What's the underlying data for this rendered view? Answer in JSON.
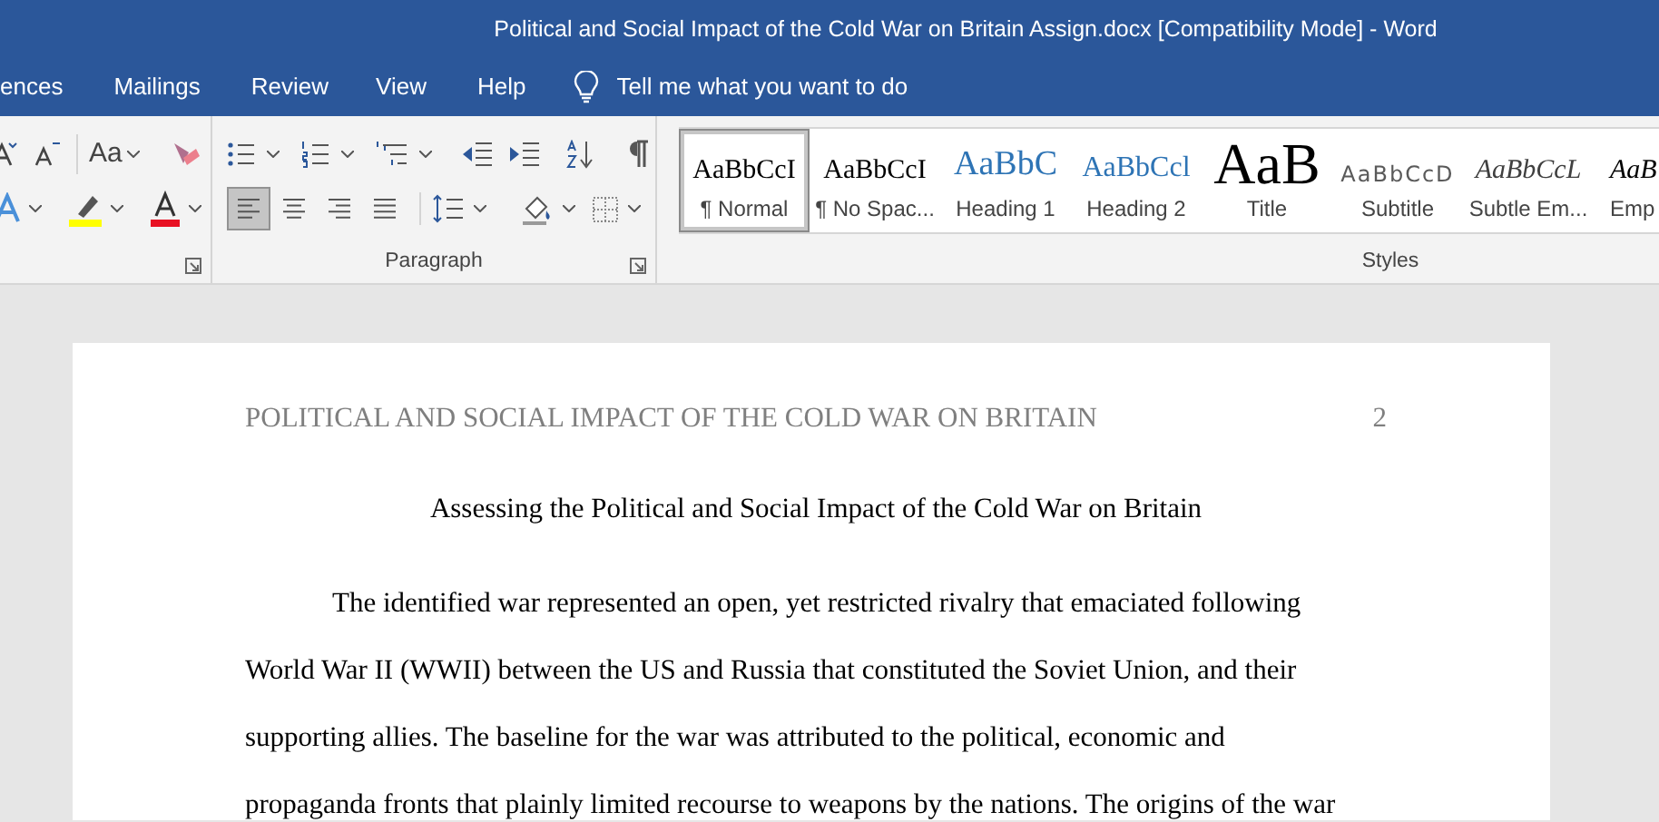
{
  "window": {
    "title": "Political and Social Impact of the Cold War on Britain Assign.docx [Compatibility Mode]  -  Word"
  },
  "tabs": [
    {
      "label": "ences",
      "selected": false
    },
    {
      "label": "Mailings",
      "selected": false
    },
    {
      "label": "Review",
      "selected": false
    },
    {
      "label": "View",
      "selected": false
    },
    {
      "label": "Help",
      "selected": false
    }
  ],
  "tell_me": {
    "placeholder": "Tell me what you want to do"
  },
  "ribbon": {
    "font": {
      "change_case": "Aa"
    },
    "paragraph": {
      "label": "Paragraph",
      "align_buttons": [
        {
          "kind": "left",
          "selected": true
        },
        {
          "kind": "center",
          "selected": false
        },
        {
          "kind": "right",
          "selected": false
        },
        {
          "kind": "justify",
          "selected": false
        }
      ]
    },
    "styles": {
      "label": "Styles",
      "items": [
        {
          "kind": "normal",
          "preview": "AaBbCcI",
          "label": "¶ Normal",
          "selected": true
        },
        {
          "kind": "no_spacing",
          "preview": "AaBbCcI",
          "label": "¶ No Spac...",
          "selected": false
        },
        {
          "kind": "heading1",
          "preview": "AaBbC",
          "label": "Heading 1",
          "selected": false
        },
        {
          "kind": "heading2",
          "preview": "AaBbCcl",
          "label": "Heading 2",
          "selected": false
        },
        {
          "kind": "title",
          "preview": "AaB",
          "label": "Title",
          "selected": false
        },
        {
          "kind": "subtitle",
          "preview": "AaBbCcD",
          "label": "Subtitle",
          "selected": false
        },
        {
          "kind": "subtle_emphasis",
          "preview": "AaBbCcL",
          "label": "Subtle Em...",
          "selected": false
        },
        {
          "kind": "emphasis",
          "preview": "AaB",
          "label": "Emp",
          "selected": false
        }
      ]
    }
  },
  "document": {
    "header": "POLITICAL AND SOCIAL IMPACT OF THE COLD WAR ON BRITAIN",
    "page_number": "2",
    "title": "Assessing the Political and Social Impact of the Cold War on Britain",
    "body_lines": [
      "The identified war represented an open, yet restricted rivalry that emaciated following",
      "World War II (WWII) between the US and Russia that constituted the Soviet Union, and their",
      "supporting allies. The baseline for the war was attributed to the political, economic and",
      "propaganda fronts that plainly limited recourse to weapons by the nations. The origins of the war"
    ]
  }
}
